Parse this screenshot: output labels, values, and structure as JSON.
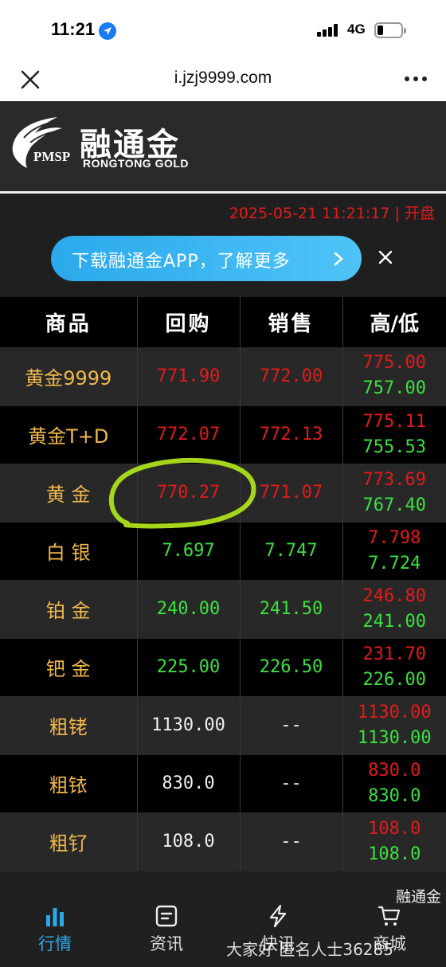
{
  "status_bar": {
    "time": "11:21",
    "network": "4G"
  },
  "browser": {
    "url": "i.jzj9999.com"
  },
  "brand": {
    "logo_mark": "PMSP",
    "name_cn": "融通金",
    "name_en": "RONGTONG  GOLD"
  },
  "market": {
    "timestamp": "2025-05-21 11:21:17 | 开盘"
  },
  "banner": {
    "text": "下载融通金APP，了解更多"
  },
  "table": {
    "headers": [
      "商品",
      "回购",
      "销售",
      "高/低"
    ],
    "rows": [
      {
        "name": "黄金9999",
        "buy": "771.90",
        "sell": "772.00",
        "high": "775.00",
        "low": "757.00"
      },
      {
        "name": "黄金T+D",
        "buy": "772.07",
        "sell": "772.13",
        "high": "775.11",
        "low": "755.53"
      },
      {
        "name": "黄 金",
        "buy": "770.27",
        "sell": "771.07",
        "high": "773.69",
        "low": "767.40"
      },
      {
        "name": "白 银",
        "buy": "7.697",
        "sell": "7.747",
        "high": "7.798",
        "low": "7.724"
      },
      {
        "name": "铂 金",
        "buy": "240.00",
        "sell": "241.50",
        "high": "246.80",
        "low": "241.00"
      },
      {
        "name": "钯 金",
        "buy": "225.00",
        "sell": "226.50",
        "high": "231.70",
        "low": "226.00"
      },
      {
        "name": "粗铑",
        "buy": "1130.00",
        "sell": "--",
        "high": "1130.00",
        "low": "1130.00"
      },
      {
        "name": "粗铱",
        "buy": "830.0",
        "sell": "--",
        "high": "830.0",
        "low": "830.0"
      },
      {
        "name": "粗钌",
        "buy": "108.0",
        "sell": "--",
        "high": "108.0",
        "low": "108.0"
      }
    ]
  },
  "bottom_nav": {
    "items": [
      {
        "label": "行情",
        "icon": "bar-chart-icon"
      },
      {
        "label": "资讯",
        "icon": "news-icon"
      },
      {
        "label": "快讯",
        "icon": "lightning-icon"
      },
      {
        "label": "商城",
        "icon": "cart-icon"
      }
    ],
    "floating_label": "融通金"
  },
  "watermark": "大家好 匿名人士36285",
  "colors": {
    "price_up": "#e21b1b",
    "price_down": "#3be040",
    "name": "#f2b84b",
    "accent": "#2aa9ec"
  }
}
